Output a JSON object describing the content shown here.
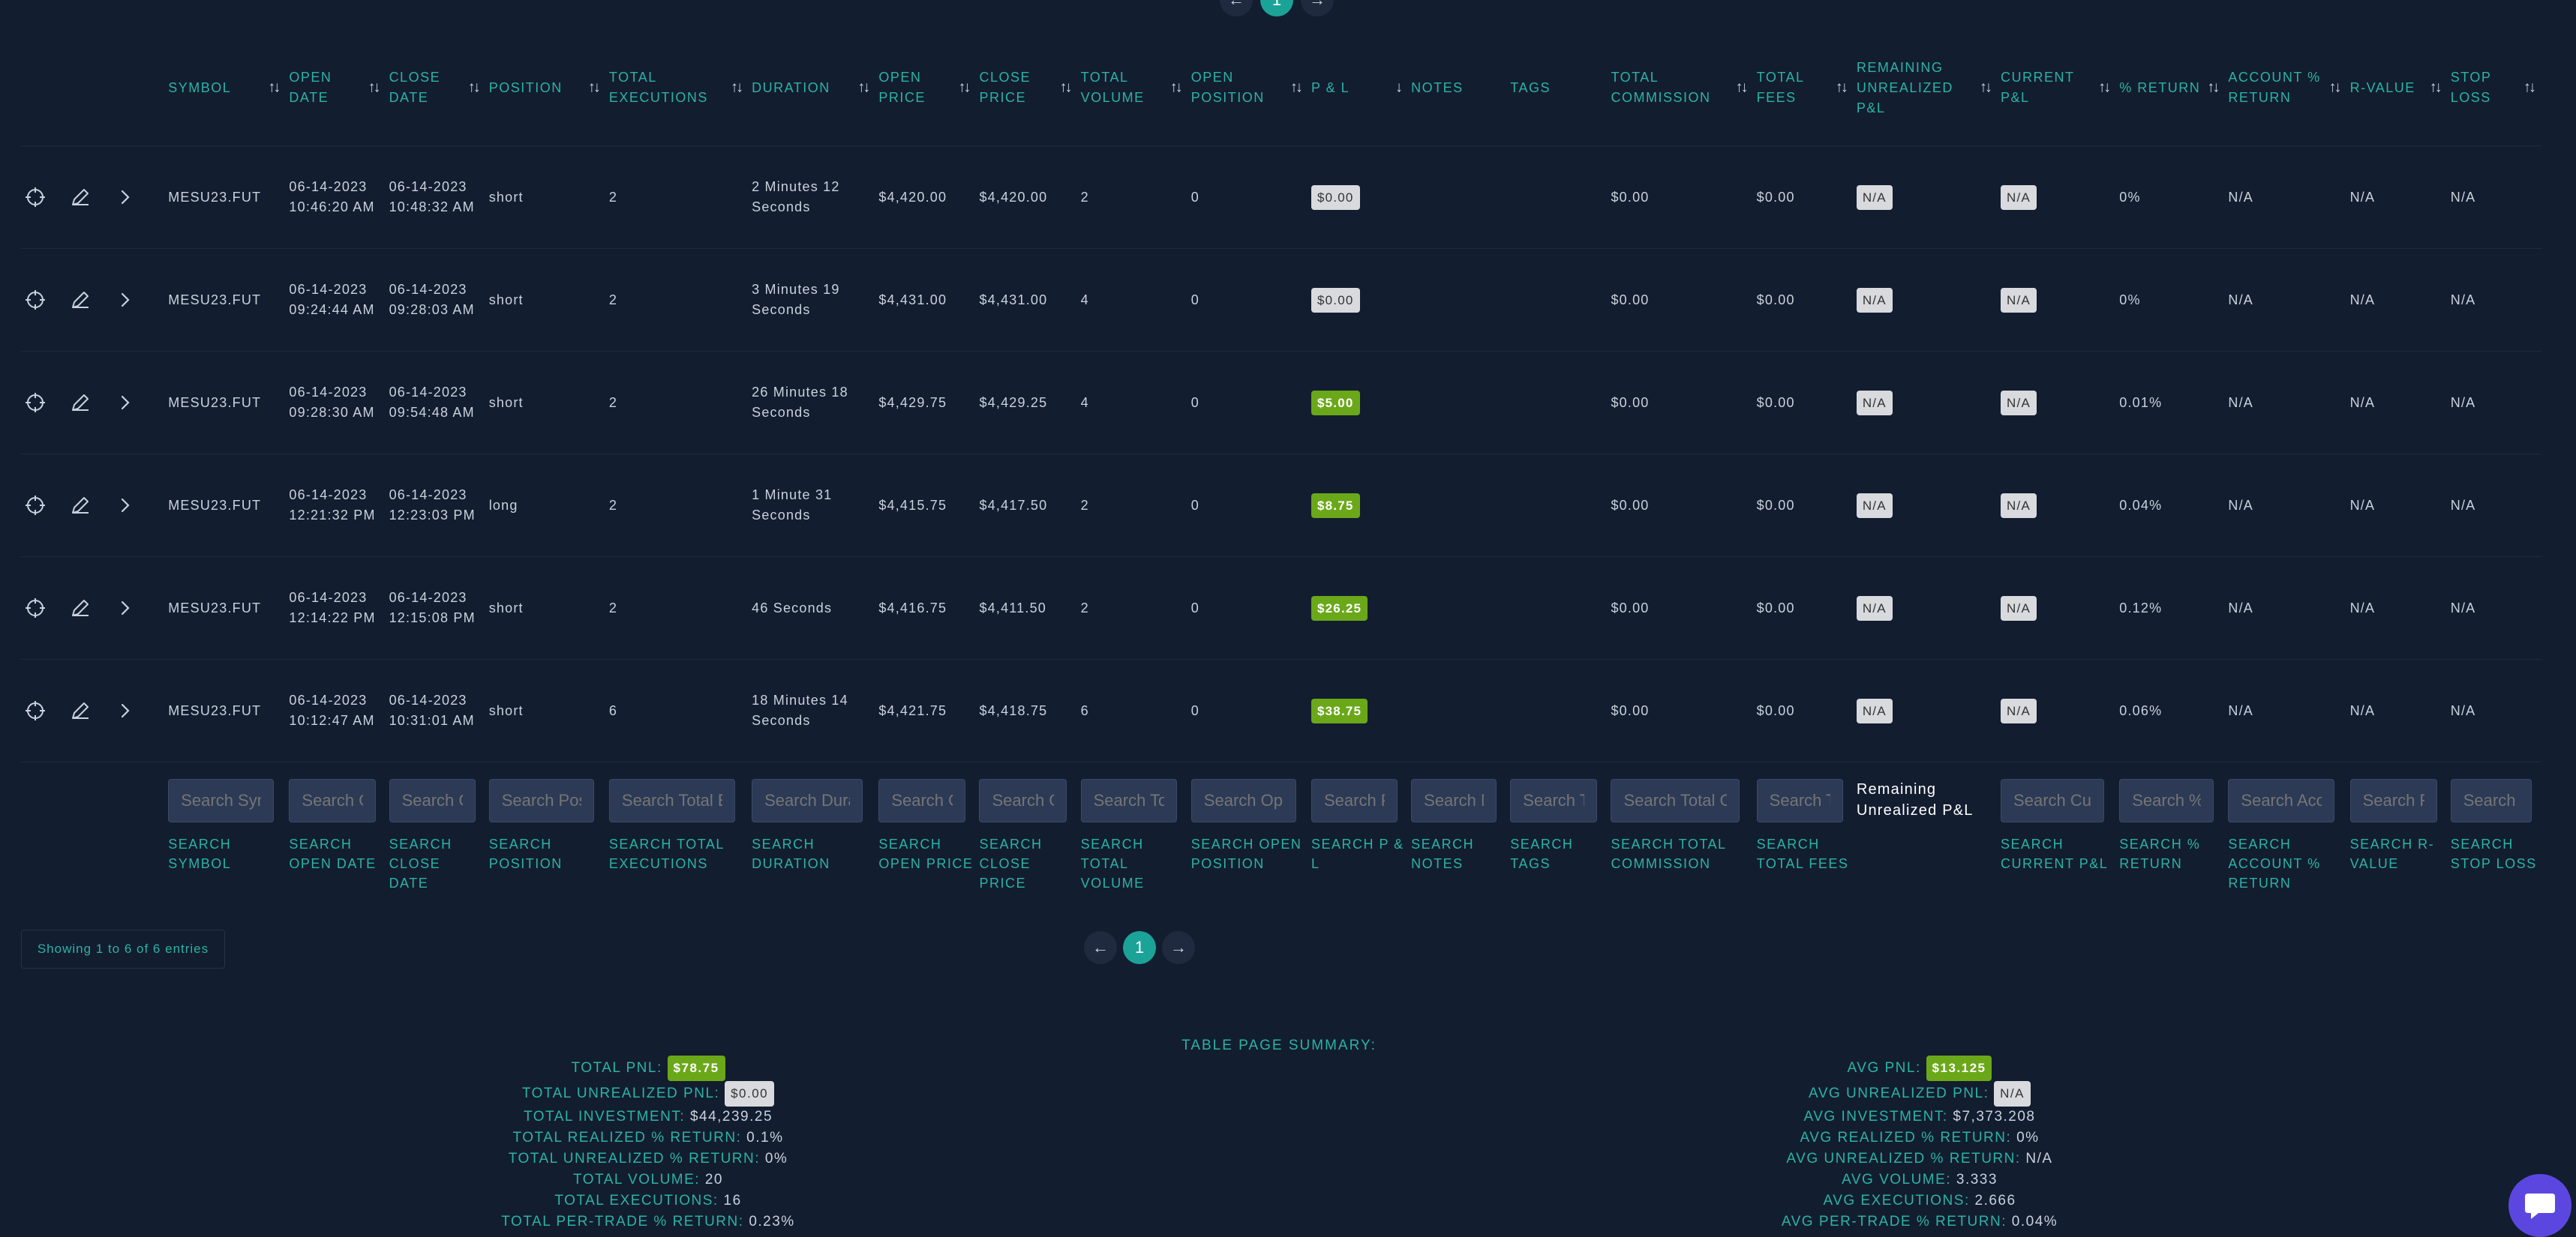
{
  "top_pager": {
    "prev": "←",
    "page": "1",
    "next": "→"
  },
  "columns": [
    {
      "key": "actions",
      "label": "",
      "sort": false
    },
    {
      "key": "symbol",
      "label": "SYMBOL",
      "sort": true
    },
    {
      "key": "open_date",
      "label": "OPEN DATE",
      "sort": true
    },
    {
      "key": "close_date",
      "label": "CLOSE DATE",
      "sort": true
    },
    {
      "key": "position",
      "label": "POSITION",
      "sort": true
    },
    {
      "key": "total_executions",
      "label": "TOTAL EXECUTIONS",
      "sort": true
    },
    {
      "key": "duration",
      "label": "DURATION",
      "sort": true
    },
    {
      "key": "open_price",
      "label": "OPEN PRICE",
      "sort": true
    },
    {
      "key": "close_price",
      "label": "CLOSE PRICE",
      "sort": true
    },
    {
      "key": "total_volume",
      "label": "TOTAL VOLUME",
      "sort": true
    },
    {
      "key": "open_position",
      "label": "OPEN POSITION",
      "sort": true
    },
    {
      "key": "pnl",
      "label": "P & L",
      "sort": true,
      "sort_icon": "↓"
    },
    {
      "key": "notes",
      "label": "NOTES",
      "sort": false
    },
    {
      "key": "tags",
      "label": "TAGS",
      "sort": false
    },
    {
      "key": "total_commission",
      "label": "TOTAL COMMISSION",
      "sort": true
    },
    {
      "key": "total_fees",
      "label": "TOTAL FEES",
      "sort": true
    },
    {
      "key": "remaining_unrealized",
      "label": "REMAINING UNREALIZED P&L",
      "sort": true
    },
    {
      "key": "current_pnl",
      "label": "CURRENT P&L",
      "sort": true
    },
    {
      "key": "pct_return",
      "label": "% RETURN",
      "sort": true
    },
    {
      "key": "account_return",
      "label": "ACCOUNT % RETURN",
      "sort": true
    },
    {
      "key": "r_value",
      "label": "R-VALUE",
      "sort": true
    },
    {
      "key": "stop_loss",
      "label": "STOP LOSS",
      "sort": true
    }
  ],
  "rows": [
    {
      "symbol": "MESU23.FUT",
      "open_date": "06-14-2023 10:46:20 AM",
      "close_date": "06-14-2023 10:48:32 AM",
      "position": "short",
      "total_executions": "2",
      "duration": "2 Minutes 12 Seconds",
      "open_price": "$4,420.00",
      "close_price": "$4,420.00",
      "total_volume": "2",
      "open_position": "0",
      "pnl": "$0.00",
      "pnl_style": "grey",
      "notes": "",
      "tags": "",
      "total_commission": "$0.00",
      "total_fees": "$0.00",
      "remaining_unrealized": "N/A",
      "current_pnl": "N/A",
      "pct_return": "0%",
      "account_return": "N/A",
      "r_value": "N/A",
      "stop_loss": "N/A"
    },
    {
      "symbol": "MESU23.FUT",
      "open_date": "06-14-2023 09:24:44 AM",
      "close_date": "06-14-2023 09:28:03 AM",
      "position": "short",
      "total_executions": "2",
      "duration": "3 Minutes 19 Seconds",
      "open_price": "$4,431.00",
      "close_price": "$4,431.00",
      "total_volume": "4",
      "open_position": "0",
      "pnl": "$0.00",
      "pnl_style": "grey",
      "notes": "",
      "tags": "",
      "total_commission": "$0.00",
      "total_fees": "$0.00",
      "remaining_unrealized": "N/A",
      "current_pnl": "N/A",
      "pct_return": "0%",
      "account_return": "N/A",
      "r_value": "N/A",
      "stop_loss": "N/A"
    },
    {
      "symbol": "MESU23.FUT",
      "open_date": "06-14-2023 09:28:30 AM",
      "close_date": "06-14-2023 09:54:48 AM",
      "position": "short",
      "total_executions": "2",
      "duration": "26 Minutes 18 Seconds",
      "open_price": "$4,429.75",
      "close_price": "$4,429.25",
      "total_volume": "4",
      "open_position": "0",
      "pnl": "$5.00",
      "pnl_style": "green",
      "notes": "",
      "tags": "",
      "total_commission": "$0.00",
      "total_fees": "$0.00",
      "remaining_unrealized": "N/A",
      "current_pnl": "N/A",
      "pct_return": "0.01%",
      "account_return": "N/A",
      "r_value": "N/A",
      "stop_loss": "N/A"
    },
    {
      "symbol": "MESU23.FUT",
      "open_date": "06-14-2023 12:21:32 PM",
      "close_date": "06-14-2023 12:23:03 PM",
      "position": "long",
      "total_executions": "2",
      "duration": "1 Minute 31 Seconds",
      "open_price": "$4,415.75",
      "close_price": "$4,417.50",
      "total_volume": "2",
      "open_position": "0",
      "pnl": "$8.75",
      "pnl_style": "green",
      "notes": "",
      "tags": "",
      "total_commission": "$0.00",
      "total_fees": "$0.00",
      "remaining_unrealized": "N/A",
      "current_pnl": "N/A",
      "pct_return": "0.04%",
      "account_return": "N/A",
      "r_value": "N/A",
      "stop_loss": "N/A"
    },
    {
      "symbol": "MESU23.FUT",
      "open_date": "06-14-2023 12:14:22 PM",
      "close_date": "06-14-2023 12:15:08 PM",
      "position": "short",
      "total_executions": "2",
      "duration": "46 Seconds",
      "open_price": "$4,416.75",
      "close_price": "$4,411.50",
      "total_volume": "2",
      "open_position": "0",
      "pnl": "$26.25",
      "pnl_style": "green",
      "notes": "",
      "tags": "",
      "total_commission": "$0.00",
      "total_fees": "$0.00",
      "remaining_unrealized": "N/A",
      "current_pnl": "N/A",
      "pct_return": "0.12%",
      "account_return": "N/A",
      "r_value": "N/A",
      "stop_loss": "N/A"
    },
    {
      "symbol": "MESU23.FUT",
      "open_date": "06-14-2023 10:12:47 AM",
      "close_date": "06-14-2023 10:31:01 AM",
      "position": "short",
      "total_executions": "6",
      "duration": "18 Minutes 14 Seconds",
      "open_price": "$4,421.75",
      "close_price": "$4,418.75",
      "total_volume": "6",
      "open_position": "0",
      "pnl": "$38.75",
      "pnl_style": "green",
      "notes": "",
      "tags": "",
      "total_commission": "$0.00",
      "total_fees": "$0.00",
      "remaining_unrealized": "N/A",
      "current_pnl": "N/A",
      "pct_return": "0.06%",
      "account_return": "N/A",
      "r_value": "N/A",
      "stop_loss": "N/A"
    }
  ],
  "search": [
    {
      "key": "actions",
      "placeholder": "",
      "label": ""
    },
    {
      "key": "symbol",
      "placeholder": "Search Symbol",
      "label": "SEARCH SYMBOL"
    },
    {
      "key": "open_date",
      "placeholder": "Search Open Date",
      "label": "SEARCH OPEN DATE"
    },
    {
      "key": "close_date",
      "placeholder": "Search Close Date",
      "label": "SEARCH CLOSE DATE"
    },
    {
      "key": "position",
      "placeholder": "Search Position",
      "label": "SEARCH POSITION"
    },
    {
      "key": "total_executions",
      "placeholder": "Search Total Executions",
      "label": "SEARCH TOTAL EXECUTIONS"
    },
    {
      "key": "duration",
      "placeholder": "Search Duration",
      "label": "SEARCH DURATION"
    },
    {
      "key": "open_price",
      "placeholder": "Search Open Price",
      "label": "SEARCH OPEN PRICE"
    },
    {
      "key": "close_price",
      "placeholder": "Search Close Price",
      "label": "SEARCH CLOSE PRICE"
    },
    {
      "key": "total_volume",
      "placeholder": "Search Total Volume",
      "label": "SEARCH TOTAL VOLUME"
    },
    {
      "key": "open_position",
      "placeholder": "Search Open Position",
      "label": "SEARCH OPEN POSITION"
    },
    {
      "key": "pnl",
      "placeholder": "Search P & L",
      "label": "SEARCH P & L"
    },
    {
      "key": "notes",
      "placeholder": "Search Notes",
      "label": "SEARCH NOTES"
    },
    {
      "key": "tags",
      "placeholder": "Search Tags",
      "label": "SEARCH TAGS"
    },
    {
      "key": "total_commission",
      "placeholder": "Search Total Commission",
      "label": "SEARCH TOTAL COMMISSION"
    },
    {
      "key": "total_fees",
      "placeholder": "Search Total Fees",
      "label": "SEARCH TOTAL FEES"
    },
    {
      "key": "remaining_unrealized",
      "placeholder": "",
      "label": "Remaining Unrealized P&L"
    },
    {
      "key": "current_pnl",
      "placeholder": "Search Current P&L",
      "label": "SEARCH CURRENT P&L"
    },
    {
      "key": "pct_return",
      "placeholder": "Search % Return",
      "label": "SEARCH % RETURN"
    },
    {
      "key": "account_return",
      "placeholder": "Search Account % Return",
      "label": "SEARCH ACCOUNT % RETURN"
    },
    {
      "key": "r_value",
      "placeholder": "Search R-Value",
      "label": "SEARCH R-VALUE"
    },
    {
      "key": "stop_loss",
      "placeholder": "Search Stop Loss",
      "label": "SEARCH STOP LOSS"
    }
  ],
  "showing": "Showing 1 to 6 of 6 entries",
  "pager": {
    "prev": "←",
    "page": "1",
    "next": "→"
  },
  "summary": {
    "title": "TABLE PAGE SUMMARY:",
    "left": [
      {
        "k": "TOTAL PNL:",
        "v": "$78.75",
        "badge": "green"
      },
      {
        "k": "TOTAL UNREALIZED PNL:",
        "v": "$0.00",
        "badge": "grey"
      },
      {
        "k": "TOTAL INVESTMENT:",
        "v": "$44,239.25"
      },
      {
        "k": "TOTAL REALIZED % RETURN:",
        "v": "0.1%"
      },
      {
        "k": "TOTAL UNREALIZED % RETURN:",
        "v": "0%"
      },
      {
        "k": "TOTAL VOLUME:",
        "v": "20"
      },
      {
        "k": "TOTAL EXECUTIONS:",
        "v": "16"
      },
      {
        "k": "TOTAL PER-TRADE % RETURN:",
        "v": "0.23%"
      }
    ],
    "right": [
      {
        "k": "AVG PNL:",
        "v": "$13.125",
        "badge": "green"
      },
      {
        "k": "AVG UNREALIZED PNL:",
        "v": "N/A",
        "badge": "grey"
      },
      {
        "k": "AVG INVESTMENT:",
        "v": "$7,373.208"
      },
      {
        "k": "AVG REALIZED % RETURN:",
        "v": "0%"
      },
      {
        "k": "AVG UNREALIZED % RETURN:",
        "v": "N/A"
      },
      {
        "k": "AVG VOLUME:",
        "v": "3.333"
      },
      {
        "k": "AVG EXECUTIONS:",
        "v": "2.666"
      },
      {
        "k": "AVG PER-TRADE % RETURN:",
        "v": "0.04%"
      }
    ]
  },
  "colors": {
    "accent": "#2bb3a5",
    "background": "#131d30",
    "profit_badge": "#6aa819",
    "neutral_badge": "#d8dadd",
    "chat": "#5b47e0"
  },
  "icons": {
    "row_actions": [
      "crosshair-icon",
      "pencil-icon",
      "chevron-right-icon"
    ],
    "chat": "chat-bubble-icon"
  }
}
